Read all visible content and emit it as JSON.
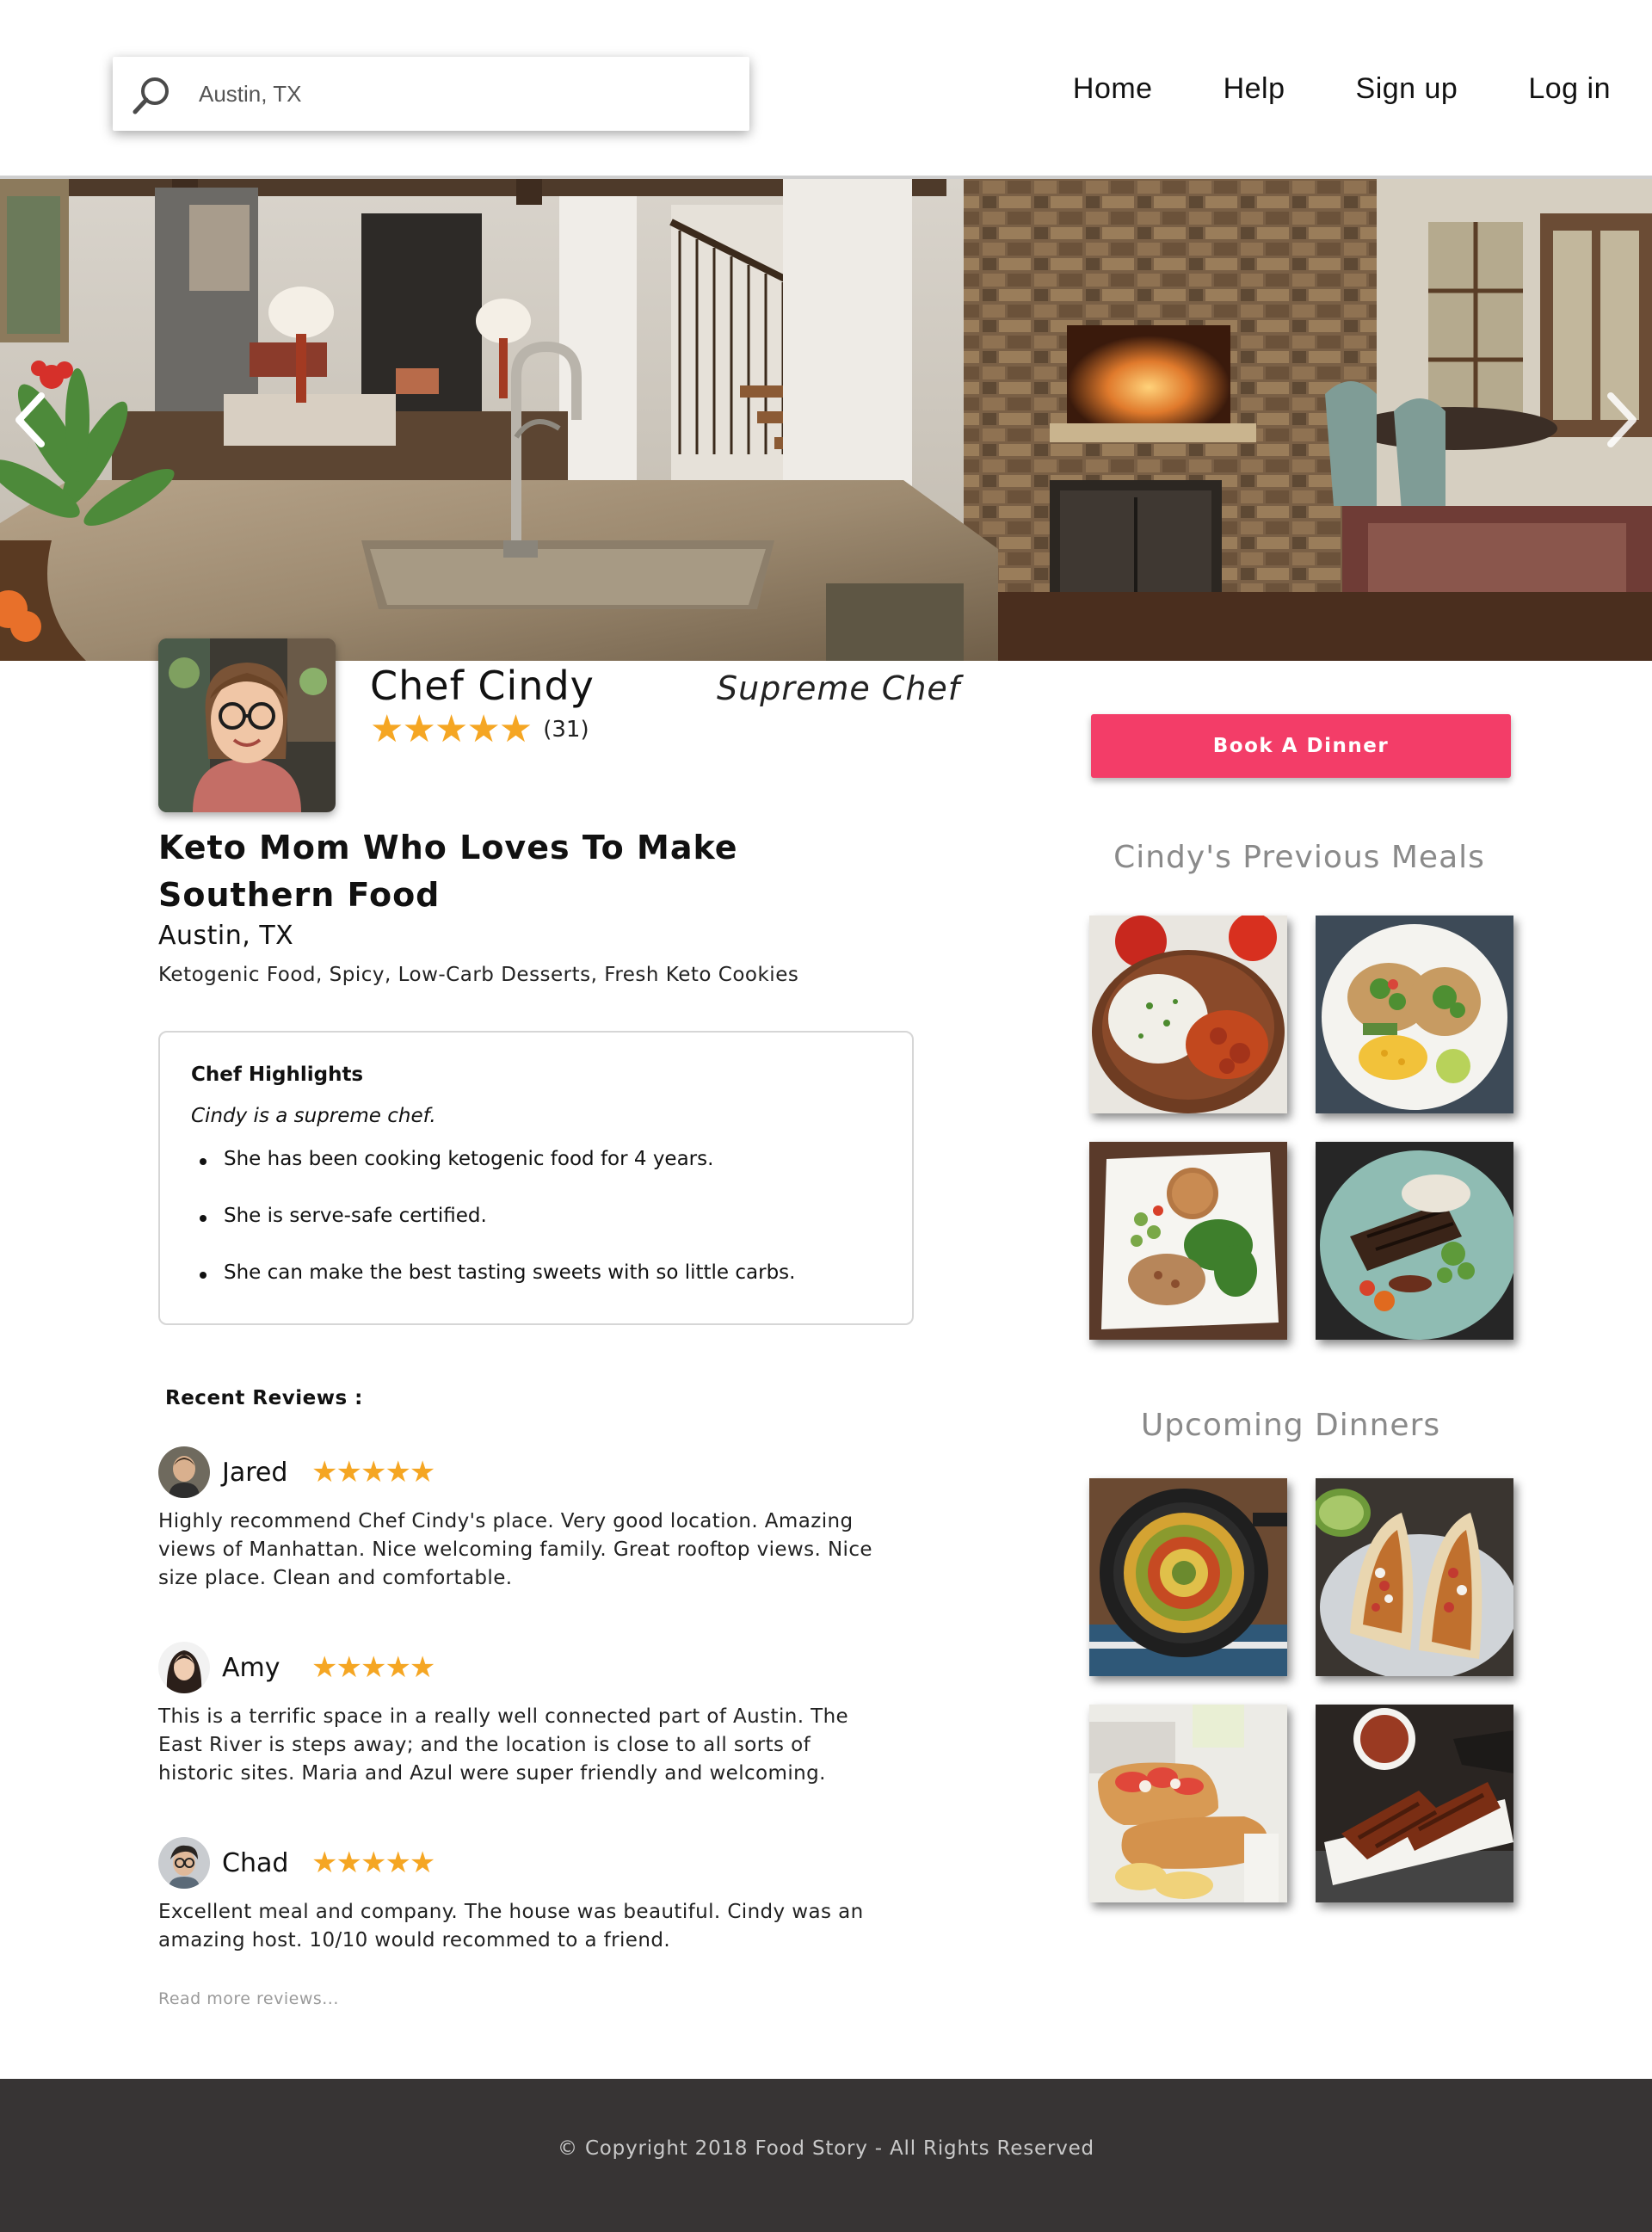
{
  "search": {
    "value": "Austin, TX"
  },
  "nav": {
    "home": "Home",
    "help": "Help",
    "signup": "Sign up",
    "login": "Log in"
  },
  "chef": {
    "name": "Chef Cindy",
    "title": "Supreme Chef",
    "rating_stars": "★★★★★",
    "rating_value": 5,
    "rating_count": "(31)",
    "tagline": "Keto Mom Who Loves To Make Southern Food",
    "location": "Austin, TX",
    "cuisines": "Ketogenic Food, Spicy, Low-Carb Desserts, Fresh Keto Cookies"
  },
  "highlights": {
    "heading": "Chef Highlights",
    "intro": "Cindy is a supreme chef.",
    "items": [
      "She has been cooking ketogenic food for 4 years.",
      "She is serve-safe certified.",
      "She can make the best tasting sweets with so little carbs."
    ]
  },
  "reviews": {
    "heading": "Recent Reviews :",
    "items": [
      {
        "name": "Jared",
        "stars": "★★★★★",
        "rating": 5,
        "text": "Highly recommend Chef Cindy's place. Very good location. Amazing views of Manhattan. Nice welcoming family. Great rooftop views. Nice size place. Clean and comfortable."
      },
      {
        "name": "Amy",
        "stars": "★★★★★",
        "rating": 5,
        "text": "This is a terrific space in a really well connected part of Austin. The East River is steps away; and the location is close to all sorts of historic sites. Maria and Azul were super friendly and welcoming."
      },
      {
        "name": "Chad",
        "stars": "★★★★★",
        "rating": 5,
        "text": "Excellent meal and company. The house was beautiful. Cindy was an amazing host. 10/10 would recommed to a friend."
      }
    ],
    "read_more": "Read more reviews..."
  },
  "book_button": "Book A Dinner",
  "previous_meals": {
    "heading": "Cindy's Previous Meals"
  },
  "upcoming_dinners": {
    "heading": "Upcoming Dinners"
  },
  "footer": {
    "copyright": "© Copyright 2018 Food Story - All Rights Reserved"
  },
  "colors": {
    "accent": "#f33d68",
    "star": "#f5a623",
    "footer_bg": "#373434"
  }
}
